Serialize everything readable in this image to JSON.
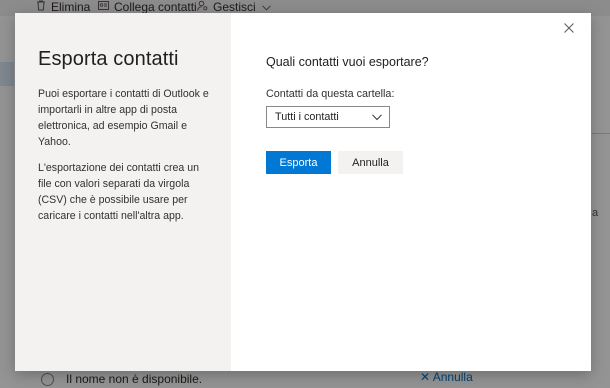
{
  "background": {
    "toolbar": {
      "delete_label": "Elimina",
      "link_contacts_label": "Collega contatti",
      "manage_label": "Gestisci"
    },
    "footer_text": "Il nome non è disponibile.",
    "footer_right_link": "Annulla"
  },
  "dialog": {
    "title": "Esporta contatti",
    "description_1": "Puoi esportare i contatti di Outlook e importarli in altre app di posta elettronica, ad esempio Gmail e Yahoo.",
    "description_2": "L'esportazione dei contatti crea un file con valori separati da virgola (CSV) che è possibile usare per caricare i contatti nell'altra app.",
    "question": "Quali contatti vuoi esportare?",
    "field_label": "Contatti da questa cartella:",
    "select_value": "Tutti i contatti",
    "export_button": "Esporta",
    "cancel_button": "Annulla"
  },
  "colors": {
    "accent": "#0078d4",
    "left_panel": "#f3f2f1"
  },
  "icons": {
    "close": "close-icon",
    "chevron": "chevron-down-icon",
    "delete": "trash-icon",
    "link": "link-icon",
    "manage": "person-gear-icon"
  }
}
